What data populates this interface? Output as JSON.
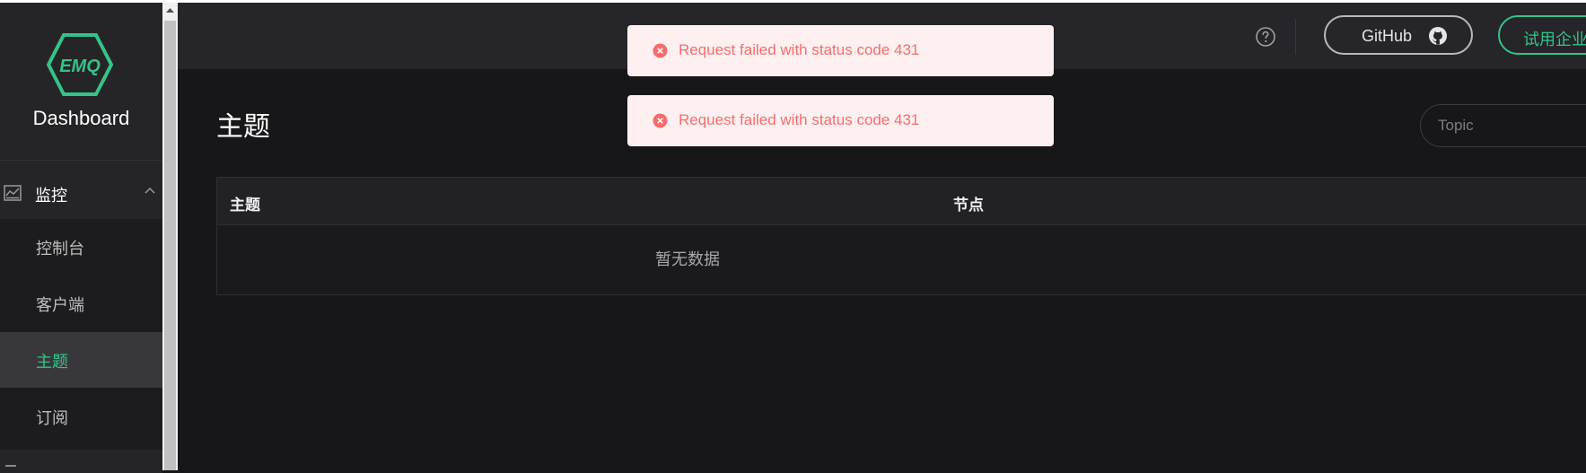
{
  "sidebar": {
    "logo_text": "EMQ",
    "brand": "Dashboard",
    "group": {
      "label": "监控",
      "icon": "chart-icon"
    },
    "items": [
      {
        "label": "控制台",
        "active": false
      },
      {
        "label": "客户端",
        "active": false
      },
      {
        "label": "主题",
        "active": true
      },
      {
        "label": "订阅",
        "active": false
      }
    ]
  },
  "header": {
    "help_icon": "question-circle-icon",
    "github_label": "GitHub",
    "trial_label": "试用企业版"
  },
  "main": {
    "title": "主题",
    "search_placeholder": "Topic",
    "table": {
      "columns": [
        "主题",
        "节点"
      ],
      "empty_text": "暂无数据"
    }
  },
  "toasts": [
    {
      "message": "Request failed with status code 431",
      "type": "error"
    },
    {
      "message": "Request failed with status code 431",
      "type": "error"
    }
  ],
  "colors": {
    "accent": "#34c388",
    "error": "#f56c6c",
    "error_bg": "#fef0f0",
    "sidebar_bg": "#252528",
    "page_bg": "#17171a"
  }
}
